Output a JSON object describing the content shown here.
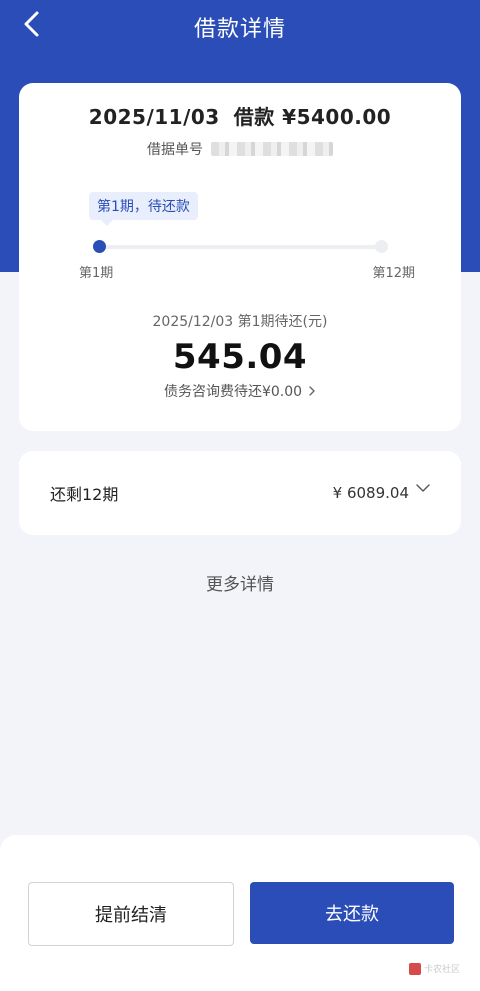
{
  "nav": {
    "title": "借款详情",
    "back_icon": "chevron-left-icon"
  },
  "loan": {
    "date": "2025/11/03",
    "amount_label": "借款 ¥5400.00",
    "number_label": "借据单号"
  },
  "progress": {
    "tip": "第1期，待还款",
    "start_label": "第1期",
    "end_label": "第12期",
    "current_period": 1,
    "total_periods": 12
  },
  "due": {
    "label": "2025/12/03 第1期待还(元)",
    "amount": "545.04",
    "fee_text": "债务咨询费待还¥0.00"
  },
  "remaining": {
    "label": "还剩12期",
    "amount": "¥ 6089.04"
  },
  "more_details": "更多详情",
  "buttons": {
    "settle": "提前结清",
    "repay": "去还款"
  },
  "watermark": "卡农社区",
  "colors": {
    "primary": "#2b4db8",
    "background": "#f3f4f9",
    "tip_bg": "#e8eefb"
  }
}
